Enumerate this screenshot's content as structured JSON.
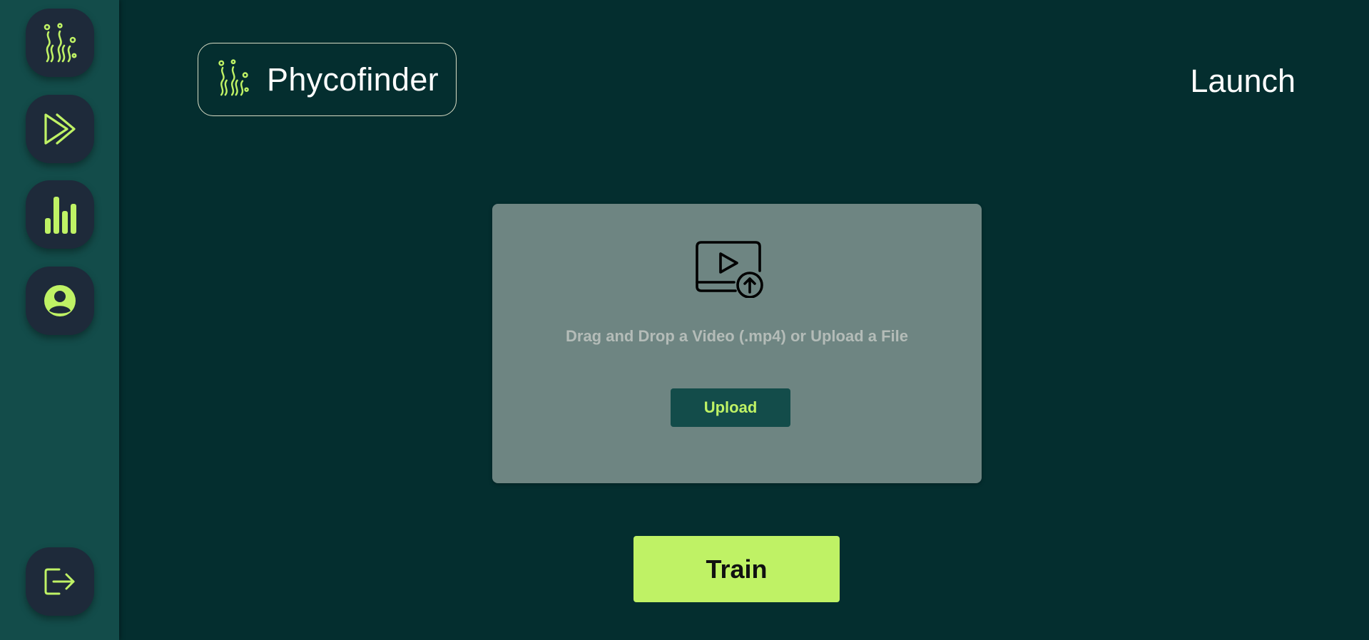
{
  "sidebar": {
    "items": [
      {
        "name": "home",
        "icon": "seaweed-icon"
      },
      {
        "name": "launch",
        "icon": "play-icon"
      },
      {
        "name": "stats",
        "icon": "bar-chart-icon"
      },
      {
        "name": "account",
        "icon": "user-circle-icon"
      }
    ],
    "logout_icon": "logout-icon"
  },
  "header": {
    "app_title": "Phycofinder",
    "logo_icon": "seaweed-icon",
    "nav_link": "Launch"
  },
  "upload": {
    "icon": "video-upload-icon",
    "instruction": "Drag and Drop a Video (.mp4) or Upload a File",
    "button_label": "Upload"
  },
  "actions": {
    "train_label": "Train"
  },
  "colors": {
    "background": "#042e2f",
    "sidebar": "#134c4a",
    "button_dark": "#1e2a3a",
    "accent": "#bff265",
    "card": "#6e8582"
  }
}
